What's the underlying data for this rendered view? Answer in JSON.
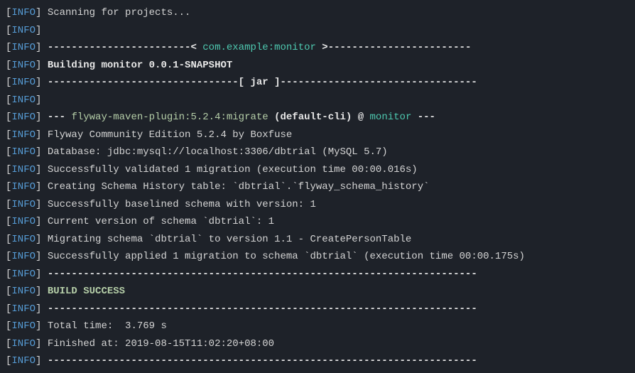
{
  "tag": {
    "open": "[",
    "label": "INFO",
    "close": "]"
  },
  "lines": {
    "l0": "Scanning for projects...",
    "l1": "",
    "l2a": "------------------------< ",
    "l2b": "com.example:monitor",
    "l2c": " >------------------------",
    "l3": "Building monitor 0.0.1-SNAPSHOT",
    "l4": "--------------------------------[ jar ]---------------------------------",
    "l5": "",
    "l6a": "--- ",
    "l6b": "flyway-maven-plugin:5.2.4:migrate",
    "l6c": " (default-cli)",
    "l6d": " @ ",
    "l6e": "monitor",
    "l6f": " ---",
    "l7": "Flyway Community Edition 5.2.4 by Boxfuse",
    "l8": "Database: jdbc:mysql://localhost:3306/dbtrial (MySQL 5.7)",
    "l9": "Successfully validated 1 migration (execution time 00:00.016s)",
    "l10": "Creating Schema History table: `dbtrial`.`flyway_schema_history`",
    "l11": "Successfully baselined schema with version: 1",
    "l12": "Current version of schema `dbtrial`: 1",
    "l13": "Migrating schema `dbtrial` to version 1.1 - CreatePersonTable",
    "l14": "Successfully applied 1 migration to schema `dbtrial` (execution time 00:00.175s)",
    "l15": "------------------------------------------------------------------------",
    "l16": "BUILD SUCCESS",
    "l17": "------------------------------------------------------------------------",
    "l18": "Total time:  3.769 s",
    "l19": "Finished at: 2019-08-15T11:02:20+08:00",
    "l20": "------------------------------------------------------------------------"
  }
}
